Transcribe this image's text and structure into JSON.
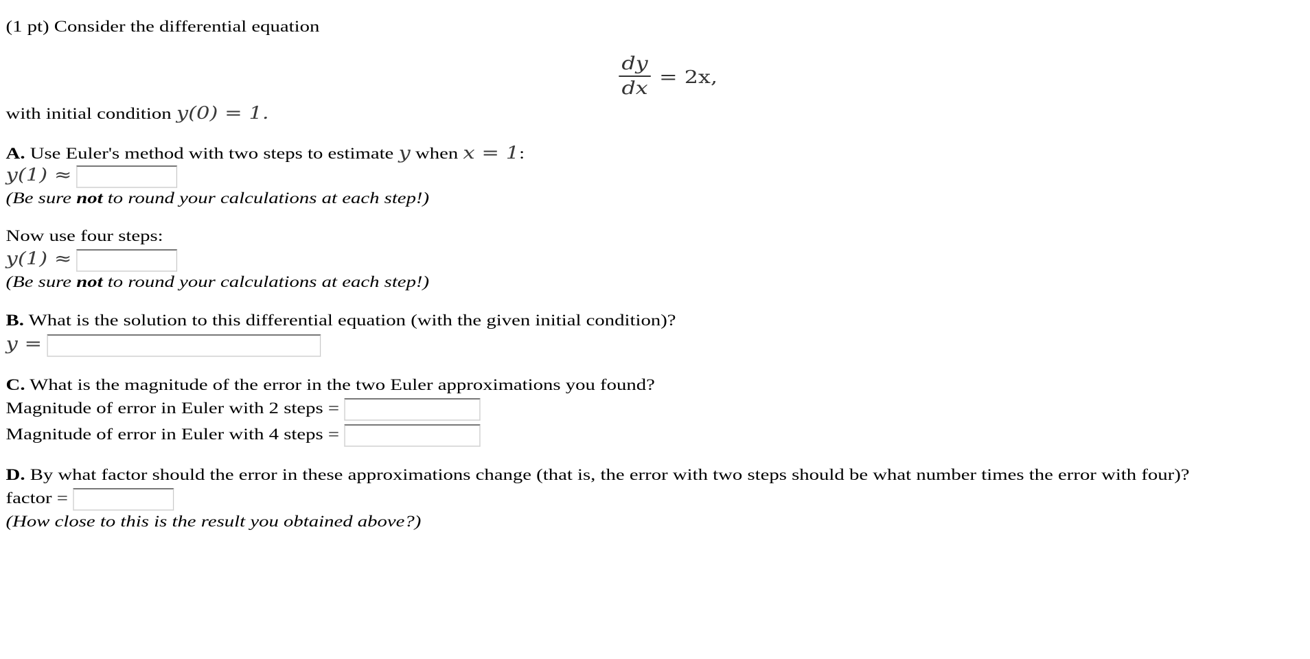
{
  "intro": {
    "points": "(1 pt) Consider the differential equation",
    "equation": {
      "numerator": "dy",
      "denominator": "dx",
      "rhs": "= 2x,"
    },
    "initial_condition_prefix": "with initial condition",
    "initial_condition_math": "y(0) = 1."
  },
  "partA": {
    "letter": "A.",
    "question_prefix": "Use Euler's method with two steps to estimate",
    "var_y": "y",
    "when": "when",
    "x_eq": "x = 1",
    "colon": ":",
    "approx_label": "y(1) ≈",
    "two_steps_value": "",
    "note_prefix": "(Be sure ",
    "note_bold": "not",
    "note_suffix": " to round your calculations at each step!)",
    "four_steps_prompt": "Now use four steps:",
    "four_steps_value": ""
  },
  "partB": {
    "letter": "B.",
    "question": "What is the solution to this differential equation (with the given initial condition)?",
    "label": "y =",
    "value": ""
  },
  "partC": {
    "letter": "C.",
    "question": "What is the magnitude of the error in the two Euler approximations you found?",
    "error2_label": "Magnitude of error in Euler with 2 steps =",
    "error2_value": "",
    "error4_label": "Magnitude of error in Euler with 4 steps =",
    "error4_value": ""
  },
  "partD": {
    "letter": "D.",
    "question": "By what factor should the error in these approximations change (that is, the error with two steps should be what number times the error with four)?",
    "label": "factor =",
    "value": "",
    "note": "(How close to this is the result you obtained above?)"
  }
}
